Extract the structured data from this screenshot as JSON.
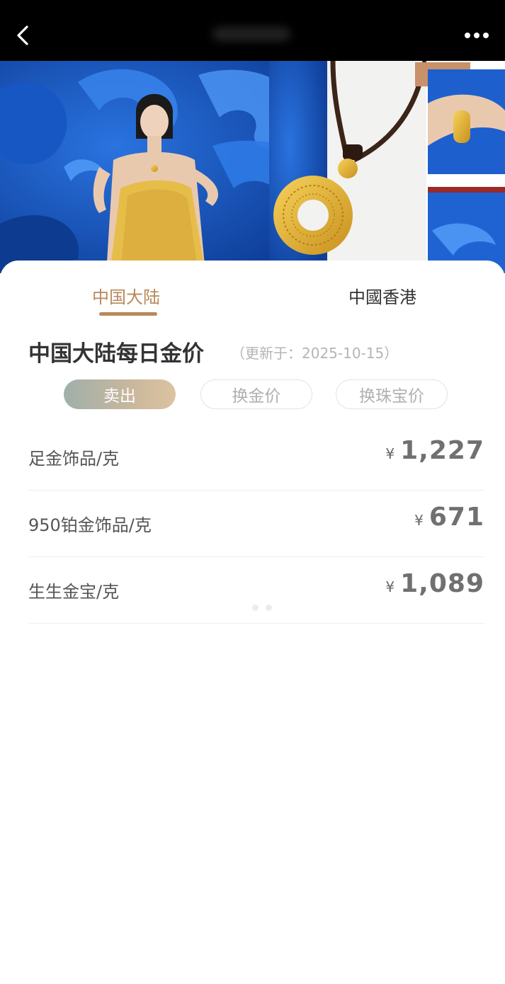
{
  "header": {
    "back_icon": "chevron-left-icon",
    "more_icon": "more-dots-icon"
  },
  "banner": {
    "image": "gold-jewelry-promo-banner",
    "colors": {
      "blue": "#1a5fc9",
      "gold": "#e2b43a"
    }
  },
  "tabs": [
    {
      "label": "中国大陆",
      "active": true
    },
    {
      "label": "中國香港",
      "active": false
    }
  ],
  "section": {
    "title": "中国大陆每日金价",
    "update_text": "（更新于：2025-10-15）"
  },
  "price_types": [
    {
      "label": "卖出",
      "active": true
    },
    {
      "label": "换金价",
      "active": false
    },
    {
      "label": "换珠宝价",
      "active": false
    }
  ],
  "prices": [
    {
      "label": "足金饰品/克",
      "currency": "¥",
      "value": "1,227"
    },
    {
      "label": "950铂金饰品/克",
      "currency": "¥",
      "value": "671"
    },
    {
      "label": "生生金宝/克",
      "currency": "¥",
      "value": "1,089"
    }
  ],
  "colors": {
    "accent": "#b8895a",
    "text_dark": "#333333",
    "text_muted": "#b5b5b5"
  }
}
